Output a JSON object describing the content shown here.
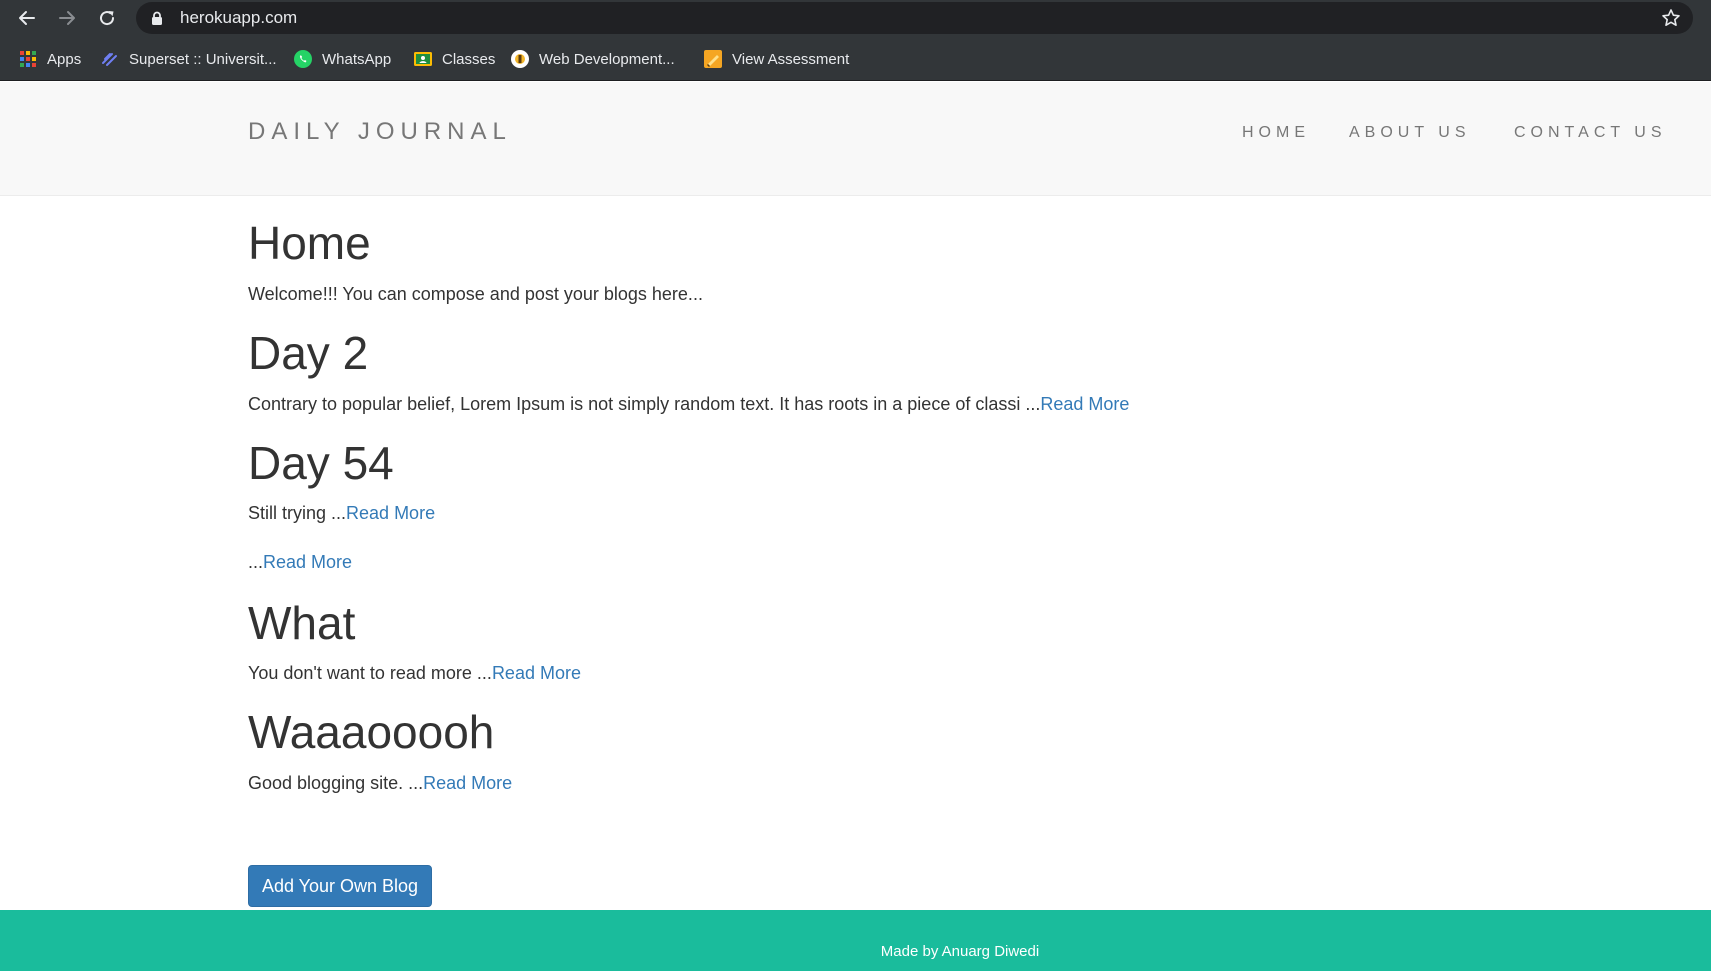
{
  "browser": {
    "url": "herokuapp.com",
    "bookmarks": [
      {
        "label": "Apps",
        "icon": "apps-grid-icon"
      },
      {
        "label": "Superset :: Universit...",
        "icon": "superset-icon"
      },
      {
        "label": "WhatsApp",
        "icon": "whatsapp-icon"
      },
      {
        "label": "Classes",
        "icon": "classroom-icon"
      },
      {
        "label": "Web Development...",
        "icon": "course-icon"
      },
      {
        "label": "View Assessment",
        "icon": "assessment-icon"
      }
    ]
  },
  "site": {
    "brand": "DAILY JOURNAL",
    "nav": [
      "HOME",
      "ABOUT US",
      "CONTACT US"
    ]
  },
  "page": {
    "title": "Home",
    "intro": "Welcome!!! You can compose and post your blogs here..."
  },
  "posts": [
    {
      "title": "Day 2",
      "excerpt": "Contrary to popular belief, Lorem Ipsum is not simply random text. It has roots in a piece of classi ...",
      "link": "Read More"
    },
    {
      "title": "Day 54",
      "excerpt": "Still trying ...",
      "link": "Read More"
    },
    {
      "title": "",
      "excerpt": "...",
      "link": "Read More"
    },
    {
      "title": "What",
      "excerpt": "You don't want to read more ...",
      "link": "Read More"
    },
    {
      "title": "Waaaooooh",
      "excerpt": "Good blogging site. ...",
      "link": "Read More"
    }
  ],
  "actions": {
    "add_blog": "Add Your Own Blog"
  },
  "footer": {
    "text": "Made by Anuarg Diwedi"
  },
  "colors": {
    "chrome": "#323639",
    "navbar": "#f8f8f8",
    "link": "#337ab7",
    "button": "#337ab7",
    "footer": "#1abc9c"
  }
}
